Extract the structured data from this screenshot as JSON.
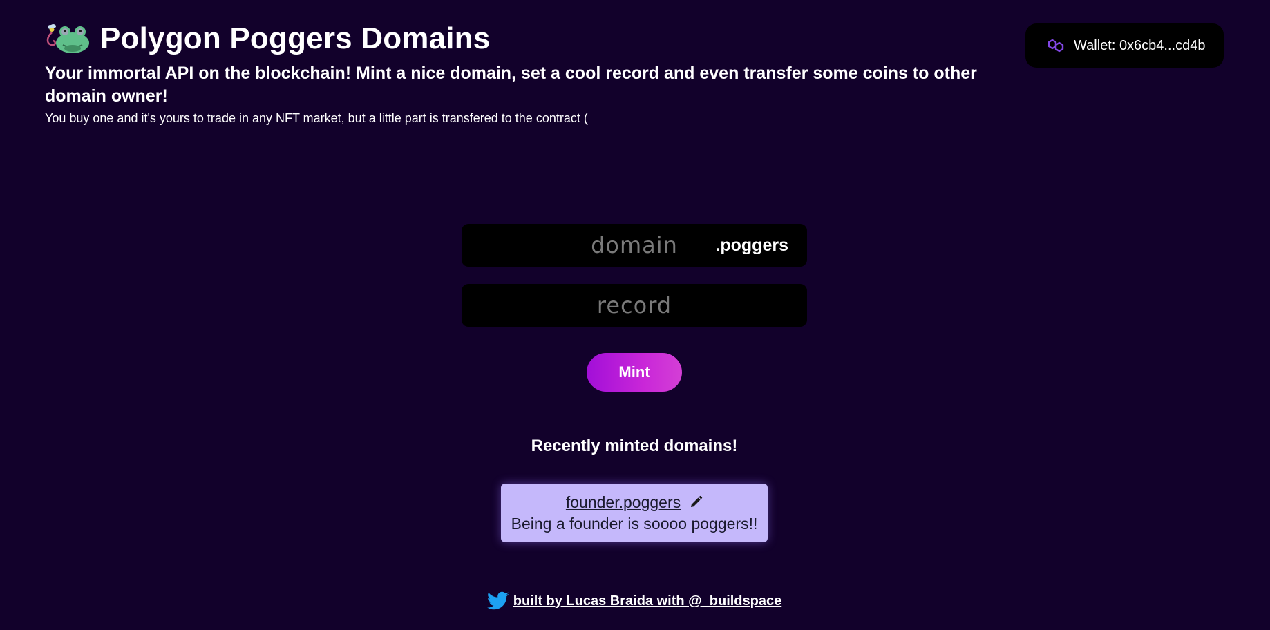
{
  "header": {
    "title": "Polygon Poggers Domains",
    "subtitle": "Your immortal API on the blockchain! Mint a nice domain, set a cool record and even transfer some coins to other domain owner!",
    "subtext": "You buy one and it's yours to trade in any NFT market, but a little part is transfered to the contract ("
  },
  "wallet": {
    "label": "Wallet: 0x6cb4...cd4b",
    "icon": "polygon-icon"
  },
  "form": {
    "domain_placeholder": "domain",
    "domain_value": "",
    "tld": ".poggers",
    "record_placeholder": "record",
    "record_value": "",
    "mint_label": "Mint"
  },
  "recent": {
    "title": "Recently minted domains!",
    "items": [
      {
        "domain": "founder.poggers",
        "record": "Being a founder is soooo poggers!!"
      }
    ]
  },
  "footer": {
    "text": "built by Lucas Braida with @_buildspace",
    "icon": "twitter-icon"
  },
  "colors": {
    "background": "#12012b",
    "field": "#000000",
    "mint_gradient_start": "#a20fd8",
    "mint_gradient_end": "#d43fd6",
    "card": "#c5b8fb",
    "polygon_purple": "#8247e5",
    "twitter_blue": "#1da1f2"
  }
}
